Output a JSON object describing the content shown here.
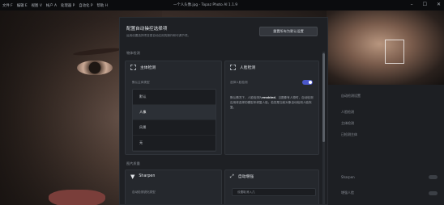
{
  "menu": [
    "文件 F",
    "编辑 E",
    "视图 V",
    "帐户 A",
    "处理器 P",
    "自动化 P",
    "帮助 H"
  ],
  "app_title": "一个人头像.jpg - Topaz Photo AI 1.1.9",
  "window_controls": {
    "minimize": "–",
    "maximize": "☐",
    "close": "✕"
  },
  "dialog": {
    "title": "配置自动操控选择项",
    "subtitle": "运用设置选择项变更自动应用的操作和可调节项。",
    "reset_button": "重置所有为默认设置",
    "section_model_detection": "物体检测",
    "subject_card": {
      "title": "主体检测",
      "caption": "默认主体类型",
      "options": [
        "默认",
        "人像",
        "风景",
        "无"
      ],
      "selected": "人像"
    },
    "face_card": {
      "title": "人脸检测",
      "toggle_label": "选择人脸检测",
      "toggle_on": true,
      "desc_pre": "默认情况下，人脸检测为",
      "desc_bold": "enabled",
      "desc_post": "。当图像有人物时，自动检测应用将选择的模型来修复人脸。若您是当前对象自动检测人脸恢复。"
    },
    "section_enhancement": "图片质量",
    "sharpen_card": {
      "title": "Sharpen",
      "caption": "自动检测锐化类型"
    },
    "denoise_card": {
      "title": "自动增强",
      "field": "设置取消入几"
    }
  },
  "right_panel": {
    "rows": [
      "自动检测设置",
      "人脸检测",
      "主体检测",
      "已检测主体",
      "Sharpen",
      "增强人脸"
    ]
  }
}
